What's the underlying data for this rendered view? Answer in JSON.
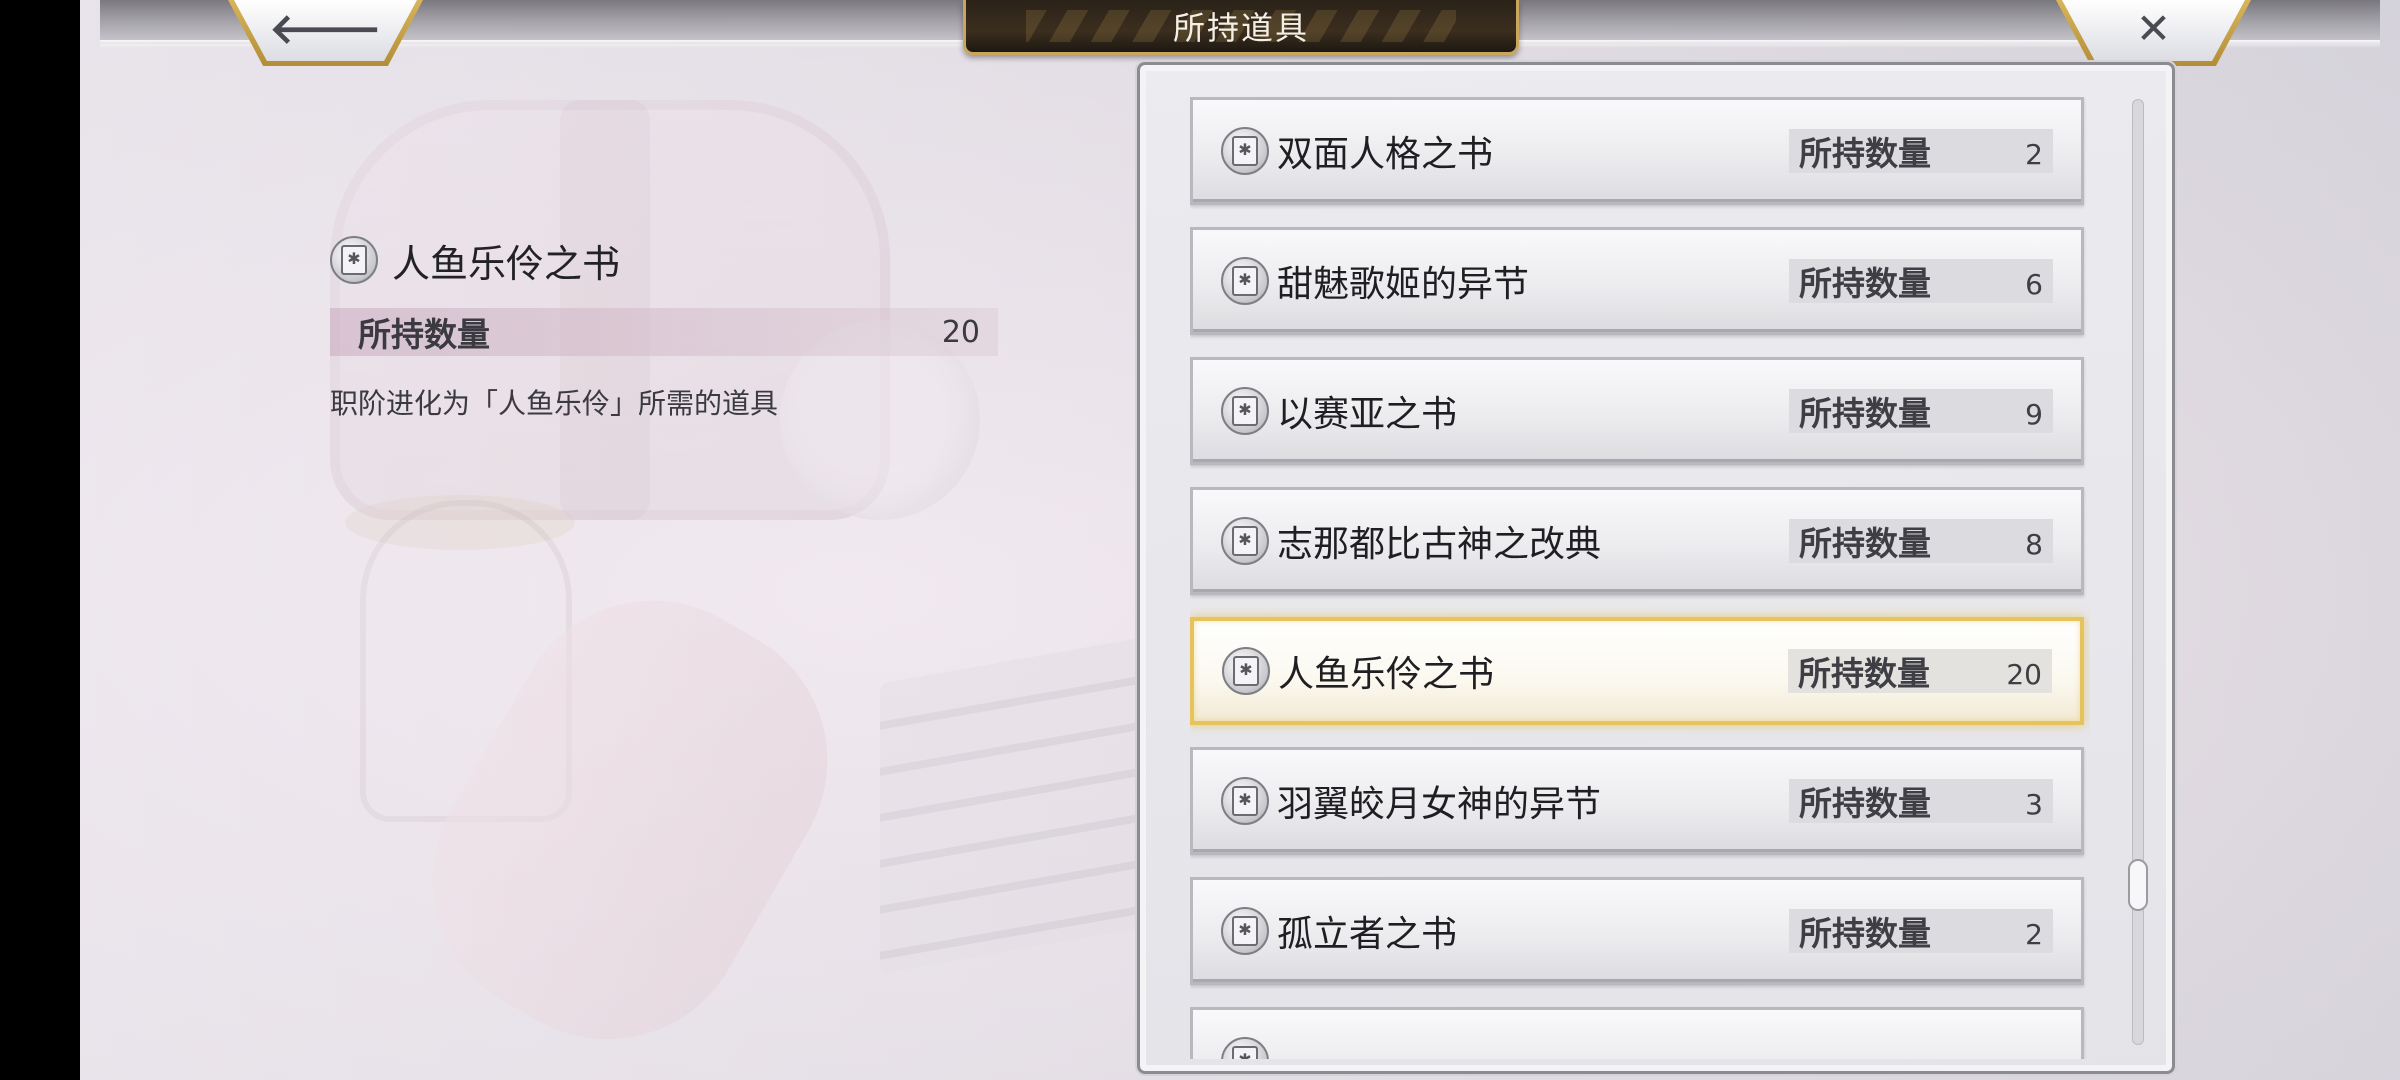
{
  "header": {
    "title": "所持道具",
    "back_glyph": "🡐",
    "close_glyph": "✕"
  },
  "detail": {
    "name": "人鱼乐伶之书",
    "count_label": "所持数量",
    "count_value": "20",
    "description": "职阶进化为「人鱼乐伶」所需的道具"
  },
  "items": [
    {
      "name": "双面人格之书",
      "count_label": "所持数量",
      "count": "2"
    },
    {
      "name": "甜魅歌姬的异节",
      "count_label": "所持数量",
      "count": "6"
    },
    {
      "name": "以赛亚之书",
      "count_label": "所持数量",
      "count": "9"
    },
    {
      "name": "志那都比古神之改典",
      "count_label": "所持数量",
      "count": "8"
    },
    {
      "name": "人鱼乐伶之书",
      "count_label": "所持数量",
      "count": "20"
    },
    {
      "name": "羽翼皎月女神的异节",
      "count_label": "所持数量",
      "count": "3"
    },
    {
      "name": "孤立者之书",
      "count_label": "所持数量",
      "count": "2"
    },
    {
      "name": "",
      "count_label": "",
      "count": ""
    }
  ],
  "selected_index": 4,
  "colors": {
    "gold_accent": "#c9a65b",
    "selection_glow": "#e7c35e",
    "title_plate": "#2a2218"
  },
  "icons": {
    "item_icon": "book-icon",
    "back": "arrow-left-icon",
    "close": "close-icon"
  },
  "scroll": {
    "position_fraction": 0.86
  }
}
